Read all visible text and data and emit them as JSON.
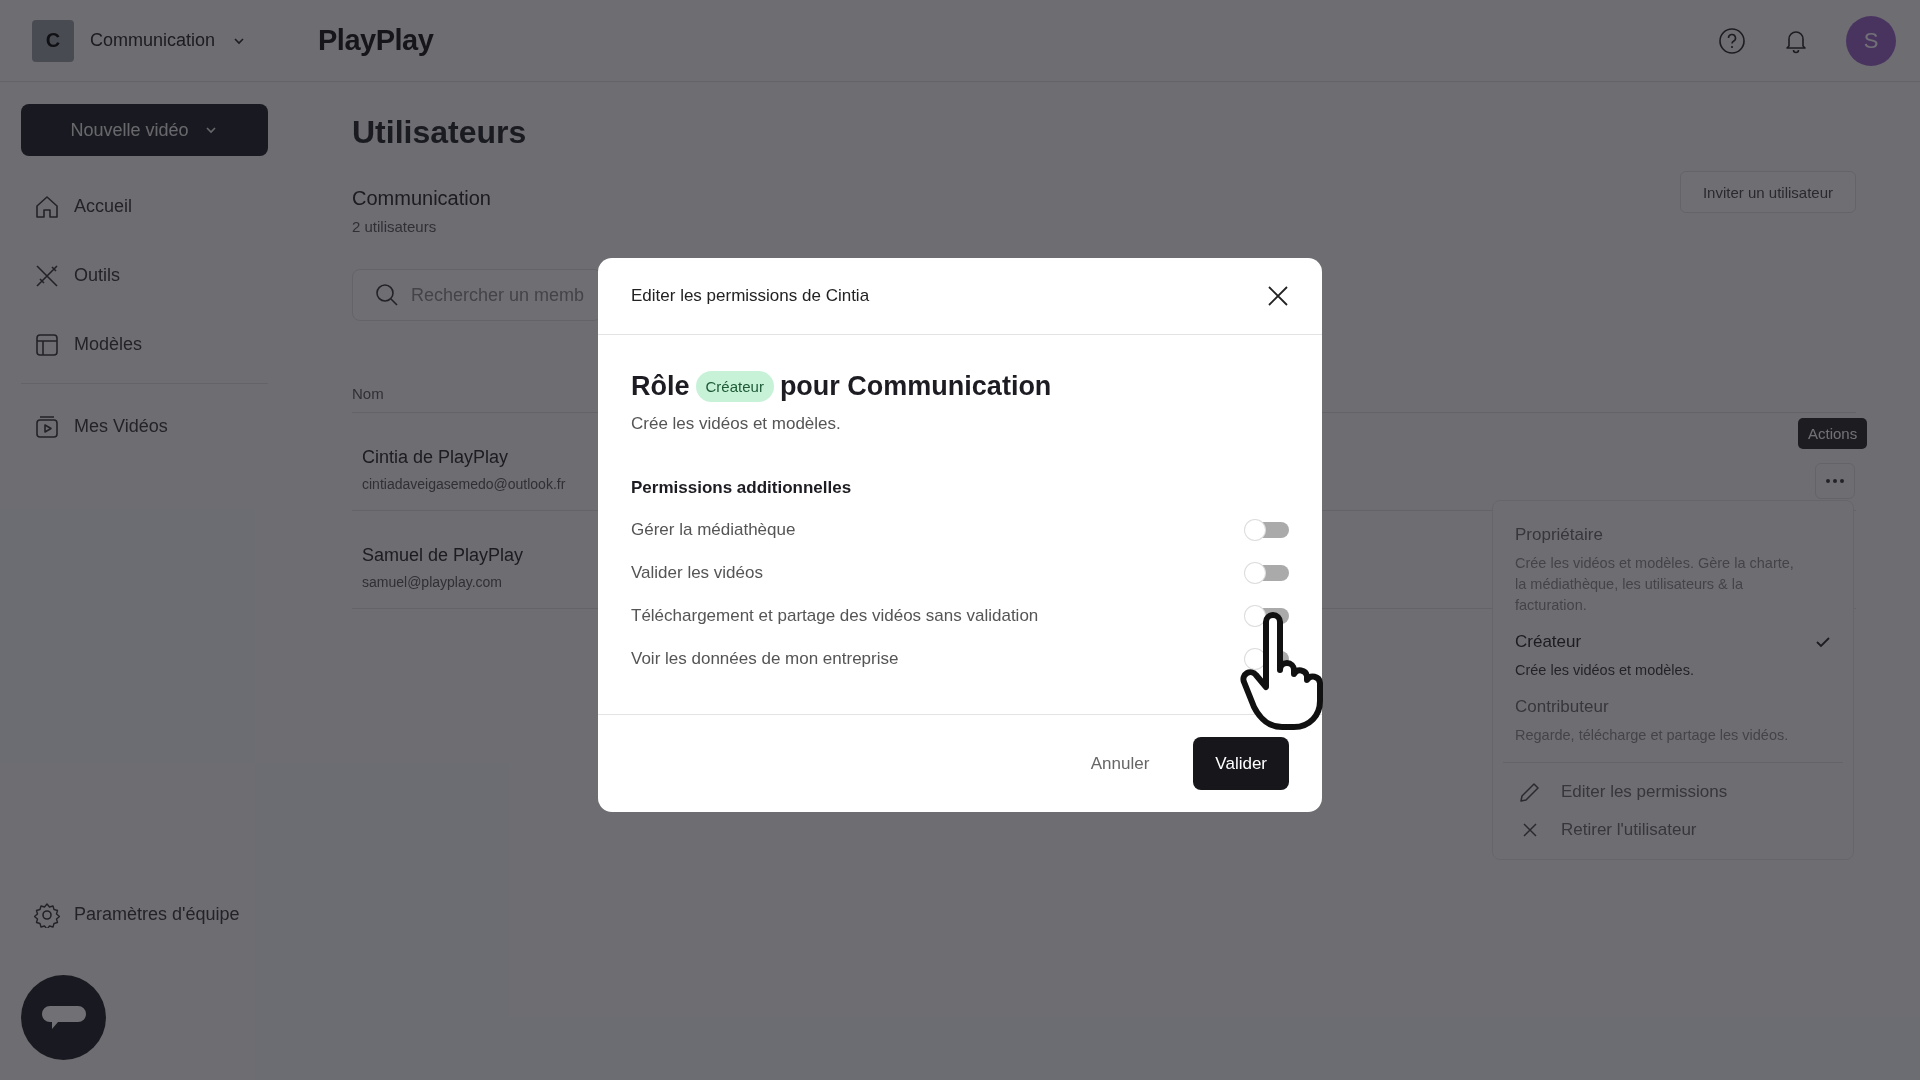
{
  "workspace": {
    "initial": "C",
    "name": "Communication"
  },
  "logo": "PlayPlay",
  "user_avatar": {
    "initial": "S"
  },
  "new_video_button": "Nouvelle vidéo",
  "sidebar": {
    "items": [
      {
        "label": "Accueil",
        "kind": "home"
      },
      {
        "label": "Outils",
        "kind": "tools"
      },
      {
        "label": "Modèles",
        "kind": "templates"
      },
      {
        "label": "Mes Vidéos",
        "kind": "videos"
      }
    ],
    "footer_item": "Paramètres d'équipe"
  },
  "page": {
    "title": "Utilisateurs",
    "team": {
      "name": "Communication",
      "count": "2 utilisateurs"
    },
    "invite_button": "Inviter un utilisateur",
    "search": {
      "placeholder": "Rechercher un memb"
    },
    "table": {
      "columns": [
        "Nom"
      ],
      "rows": [
        {
          "name": "Cintia de PlayPlay",
          "email": "cintiadaveigasemedo@outlook.fr"
        },
        {
          "name": "Samuel de PlayPlay",
          "email": "samuel@playplay.com"
        }
      ]
    }
  },
  "actions_tooltip": "Actions",
  "role_menu": {
    "roles": [
      {
        "name": "Propriétaire",
        "description": "Crée les vidéos et modèles. Gère la charte, la médiathèque, les utilisateurs & la facturation.",
        "selected": false
      },
      {
        "name": "Créateur",
        "description": "Crée les vidéos et modèles.",
        "selected": true
      },
      {
        "name": "Contributeur",
        "description": "Regarde, télécharge et partage les vidéos.",
        "selected": false
      }
    ],
    "actions": [
      {
        "label": "Editer les permissions",
        "kind": "edit"
      },
      {
        "label": "Retirer l'utilisateur",
        "kind": "remove"
      }
    ]
  },
  "modal": {
    "title": "Editer les permissions de Cintia",
    "role_prefix": "Rôle",
    "role_badge": "Créateur",
    "role_suffix": "pour Communication",
    "role_description": "Crée les vidéos et modèles.",
    "permissions_title": "Permissions additionnelles",
    "permissions": [
      {
        "label": "Gérer la médiathèque",
        "on": false
      },
      {
        "label": "Valider les vidéos",
        "on": false
      },
      {
        "label": "Téléchargement et partage des vidéos sans validation",
        "on": false
      },
      {
        "label": "Voir les données de mon entreprise",
        "on": false
      }
    ],
    "buttons": {
      "cancel": "Annuler",
      "confirm": "Valider"
    }
  }
}
